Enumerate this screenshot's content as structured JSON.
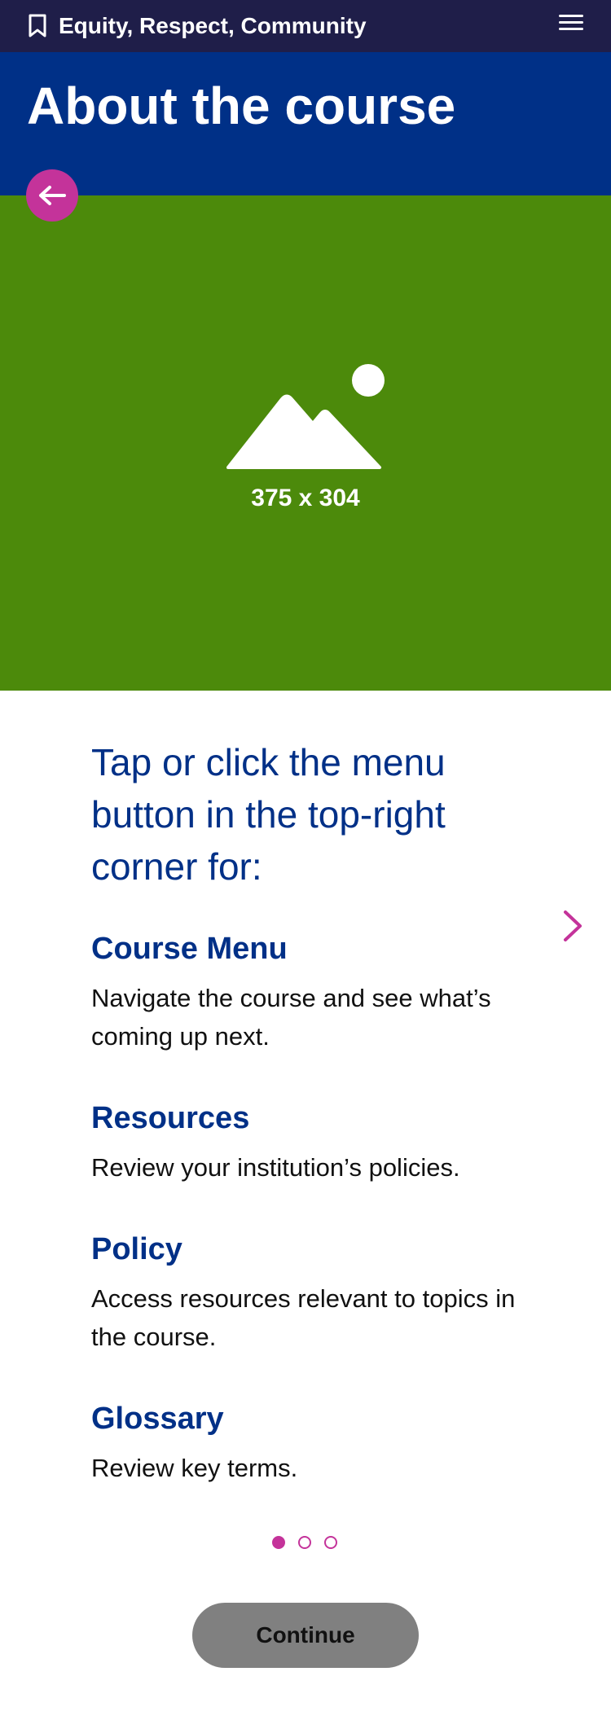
{
  "topbar": {
    "course_name": "Equity, Respect, Community",
    "bookmark_icon": "bookmark-icon",
    "menu_icon": "hamburger-menu-icon"
  },
  "header": {
    "title": "About the course"
  },
  "back_button": {
    "icon": "arrow-left-icon"
  },
  "hero": {
    "placeholder_icon": "image-placeholder-icon",
    "caption": "375 x 304"
  },
  "content": {
    "intro": "Tap or click the menu button in the top-right corner for:",
    "items": [
      {
        "title": "Course Menu",
        "description": "Navigate the course and see what’s coming up next."
      },
      {
        "title": "Resources",
        "description": "Review your institution’s policies."
      },
      {
        "title": "Policy",
        "description": "Access resources relevant to topics in the course."
      },
      {
        "title": "Glossary",
        "description": "Review key terms."
      }
    ]
  },
  "pagination": {
    "pages": 3,
    "current": 1
  },
  "next_button": {
    "icon": "chevron-right-icon"
  },
  "continue_label": "Continue",
  "colors": {
    "topbar": "#1f1e49",
    "header": "#003087",
    "hero": "#4c8a0b",
    "accent": "#c4339a",
    "button": "#808080"
  }
}
